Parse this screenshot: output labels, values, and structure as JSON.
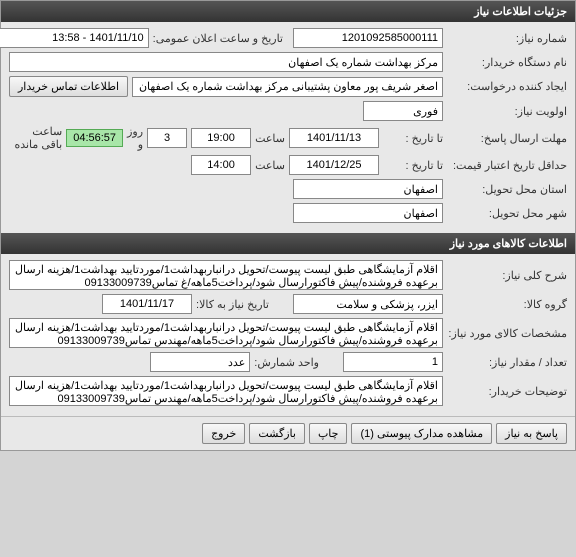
{
  "sections": {
    "details_header": "جزئیات اطلاعات نیاز",
    "items_header": "اطلاعات کالاهای مورد نیاز"
  },
  "labels": {
    "need_number": "شماره نیاز:",
    "announce_datetime": "تاریخ و ساعت اعلان عمومی:",
    "buyer_org": "نام دستگاه خریدار:",
    "request_creator": "ایجاد کننده درخواست:",
    "contact_btn": "اطلاعات تماس خریدار",
    "priority": "اولویت نیاز:",
    "reply_deadline": "مهلت ارسال پاسخ:",
    "to_date": "تا تاریخ :",
    "hour": "ساعت",
    "days_and": "روز و",
    "hours_remain": "ساعت باقی مانده",
    "price_validity": "حداقل تاریخ اعتبار قیمت:",
    "delivery_province": "استان محل تحویل:",
    "delivery_city": "شهر محل تحویل:",
    "need_desc": "شرح کلی نیاز:",
    "item_group": "گروه کالا:",
    "item_date": "تاریخ نیاز به کالا:",
    "item_spec": "مشخصات کالای مورد نیاز:",
    "qty": "تعداد / مقدار نیاز:",
    "unit": "واحد شمارش:",
    "buyer_notes": "توضیحات خریدار:"
  },
  "values": {
    "need_number": "1201092585000111",
    "announce_datetime": "1401/11/10 - 13:58",
    "buyer_org": "مرکز بهداشت شماره یک اصفهان",
    "request_creator": "اصغر شریف پور معاون پشتیبانی مرکز بهداشت شماره یک اصفهان",
    "priority": "فوری",
    "reply_date": "1401/11/13",
    "reply_time": "19:00",
    "days_remain": "3",
    "timer": "04:56:57",
    "price_date": "1401/12/25",
    "price_time": "14:00",
    "province": "اصفهان",
    "city": "اصفهان",
    "need_desc": "اقلام آزمایشگاهی طبق لیست پیوست/تحویل درانباربهداشت1/موردتایید بهداشت1/هزینه ارسال برعهده فروشنده/پیش فاکتورارسال شود/پرداخت5ماهه/غ تماس09133009739",
    "item_group": "ایزر، پزشکی و سلامت",
    "item_date": "1401/11/17",
    "item_spec": "اقلام آزمایشگاهی طبق لیست پیوست/تحویل درانباربهداشت1/موردتایید بهداشت1/هزینه ارسال برعهده فروشنده/پیش فاکتورارسال شود/پرداخت5ماهه/مهندس تماس09133009739",
    "qty": "1",
    "unit": "عدد",
    "buyer_notes": "اقلام آزمایشگاهی طبق لیست پیوست/تحویل درانباربهداشت1/موردتایید بهداشت1/هزینه ارسال برعهده فروشنده/پیش فاکتورارسال شود/پرداخت5ماهه/مهندس تماس09133009739"
  },
  "buttons": {
    "respond": "پاسخ به نیاز",
    "attachments": "مشاهده مدارک پیوستی (1)",
    "print": "چاپ",
    "back": "بازگشت",
    "exit": "خروج"
  }
}
